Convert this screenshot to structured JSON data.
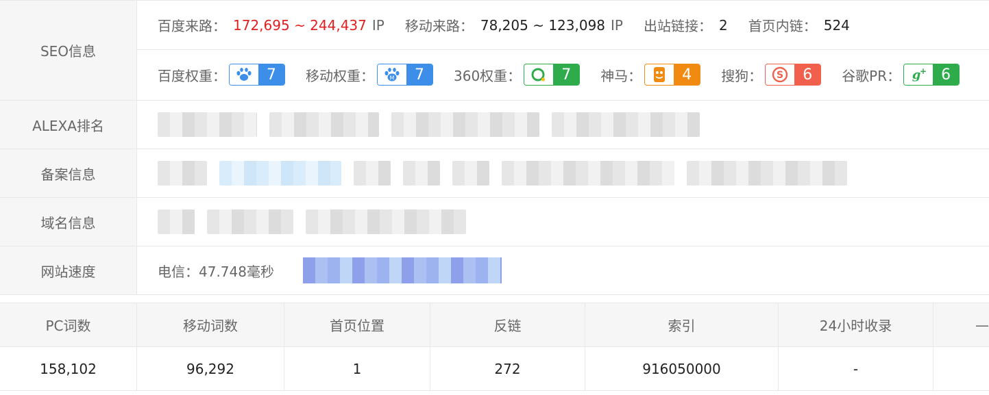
{
  "seo": {
    "label": "SEO信息",
    "baidu_traffic_label": "百度来路：",
    "baidu_traffic_value": "172,695 ~ 244,437",
    "baidu_traffic_unit": "IP",
    "mobile_traffic_label": "移动来路：",
    "mobile_traffic_value": "78,205 ~ 123,098",
    "mobile_traffic_unit": "IP",
    "outbound_label": "出站链接：",
    "outbound_value": "2",
    "homepage_internal_label": "首页内链：",
    "homepage_internal_value": "524",
    "weights": [
      {
        "label": "百度权重：",
        "value": "7",
        "icon": "baidu-paw-icon",
        "color": "#3c8ee8"
      },
      {
        "label": "移动权重：",
        "value": "7",
        "icon": "baidu-mobile-icon",
        "color": "#3c8ee8"
      },
      {
        "label": "360权重：",
        "value": "7",
        "icon": "360-icon",
        "color": "#2eac4c"
      },
      {
        "label": "神马：",
        "value": "4",
        "icon": "shenma-icon",
        "color": "#f08a10"
      },
      {
        "label": "搜狗：",
        "value": "6",
        "icon": "sogou-icon",
        "color": "#f0604c"
      },
      {
        "label": "谷歌PR：",
        "value": "6",
        "icon": "google-plus-icon",
        "color": "#2eac4c"
      }
    ]
  },
  "alexa": {
    "label": "ALEXA排名"
  },
  "icp": {
    "label": "备案信息"
  },
  "domain": {
    "label": "域名信息"
  },
  "speed": {
    "label": "网站速度",
    "telecom": "电信：47.748毫秒"
  },
  "stats": {
    "headers": [
      "PC词数",
      "移动词数",
      "首页位置",
      "反链",
      "索引",
      "24小时收录",
      "—"
    ],
    "values": [
      "158,102",
      "96,292",
      "1",
      "272",
      "916050000",
      "-",
      ""
    ]
  }
}
